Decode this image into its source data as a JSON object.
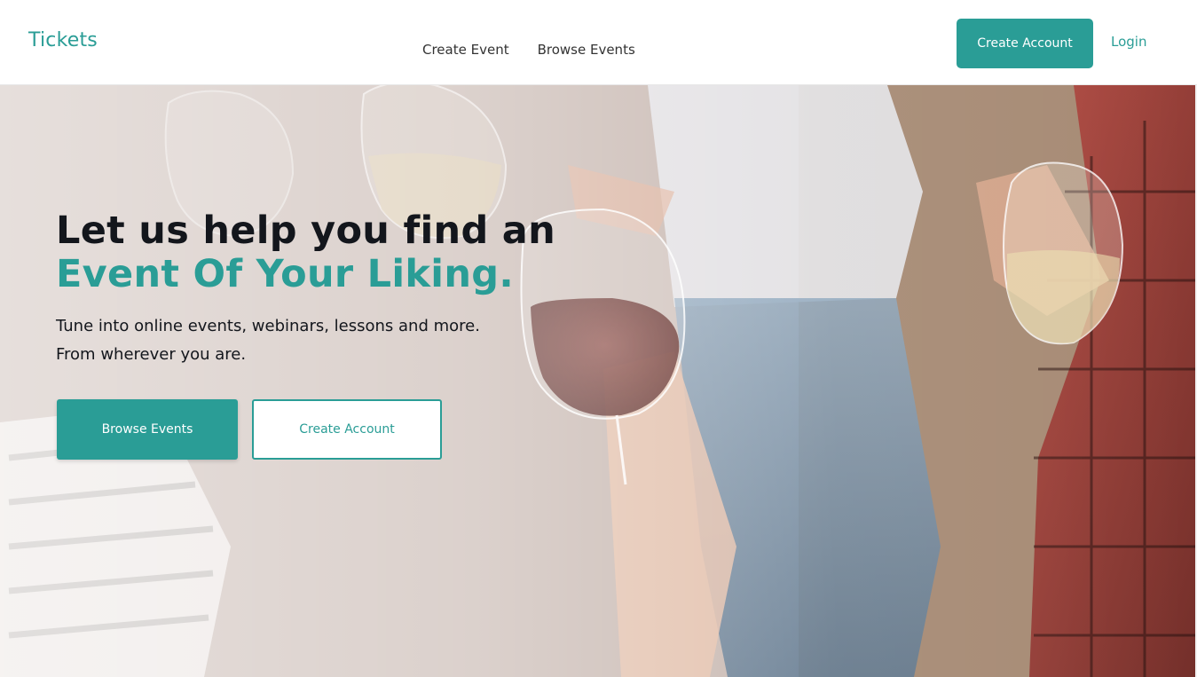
{
  "header": {
    "logo": "Tickets",
    "nav": [
      "Create Event",
      "Browse Events"
    ],
    "create_account": "Create Account",
    "login": "Login"
  },
  "hero": {
    "headline_line1": "Let us help you find an",
    "headline_line2": "Event Of Your Liking.",
    "subtext_line1": "Tune into online events, webinars, lessons and more.",
    "subtext_line2": "From wherever you are.",
    "primary_button": "Browse Events",
    "secondary_button": "Create Account"
  },
  "colors": {
    "accent": "#2a9d96",
    "text": "#13161c",
    "background": "#ffffff"
  }
}
